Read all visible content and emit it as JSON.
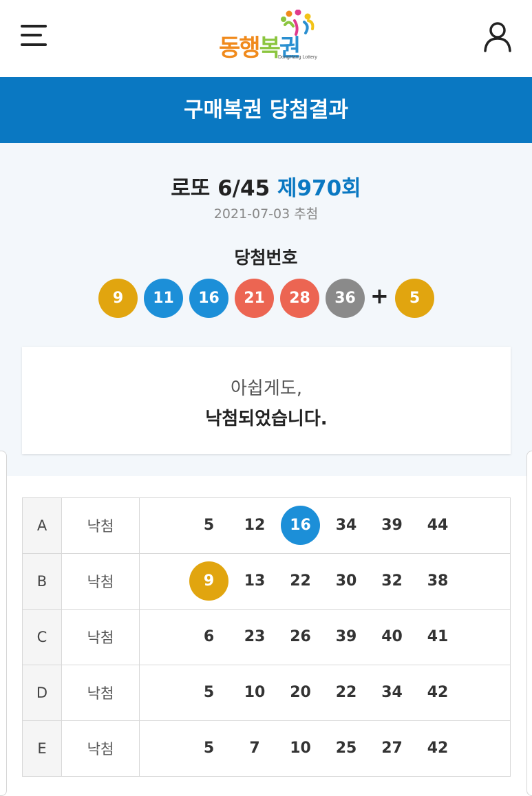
{
  "header": {
    "logo_brand": "동행복권",
    "logo_subtitle": "DongHang Lottery",
    "menu_icon": "hamburger-menu-icon",
    "user_icon": "user-profile-icon"
  },
  "page_title": "구매복권 당첨결과",
  "result": {
    "game_name": "로또 6/45",
    "round": "제970회",
    "draw_date": "2021-07-03 추첨",
    "winning_label": "당첨번호",
    "winning_numbers": [
      {
        "value": "9",
        "color": "#e1a50f"
      },
      {
        "value": "11",
        "color": "#1c8fd8"
      },
      {
        "value": "16",
        "color": "#1c8fd8"
      },
      {
        "value": "21",
        "color": "#ec6552"
      },
      {
        "value": "28",
        "color": "#ec6552"
      },
      {
        "value": "36",
        "color": "#8a8a8a"
      }
    ],
    "plus_sign": "+",
    "bonus_number": {
      "value": "5",
      "color": "#e1a50f"
    }
  },
  "message": {
    "line1": "아쉽게도,",
    "line2": "낙첨되었습니다."
  },
  "tickets": [
    {
      "id": "A",
      "status": "낙첨",
      "numbers": [
        "5",
        "12",
        "16",
        "34",
        "39",
        "44"
      ],
      "matched": [
        "16"
      ]
    },
    {
      "id": "B",
      "status": "낙첨",
      "numbers": [
        "9",
        "13",
        "22",
        "30",
        "32",
        "38"
      ],
      "matched": [
        "9"
      ]
    },
    {
      "id": "C",
      "status": "낙첨",
      "numbers": [
        "6",
        "23",
        "26",
        "39",
        "40",
        "41"
      ],
      "matched": []
    },
    {
      "id": "D",
      "status": "낙첨",
      "numbers": [
        "5",
        "10",
        "20",
        "22",
        "34",
        "42"
      ],
      "matched": []
    },
    {
      "id": "E",
      "status": "낙첨",
      "numbers": [
        "5",
        "7",
        "10",
        "25",
        "27",
        "42"
      ],
      "matched": []
    }
  ],
  "colors": {
    "brand_blue": "#0a78c2",
    "ball_yellow": "#e1a50f",
    "ball_blue": "#1c8fd8",
    "ball_red": "#ec6552",
    "ball_gray": "#8a8a8a"
  }
}
